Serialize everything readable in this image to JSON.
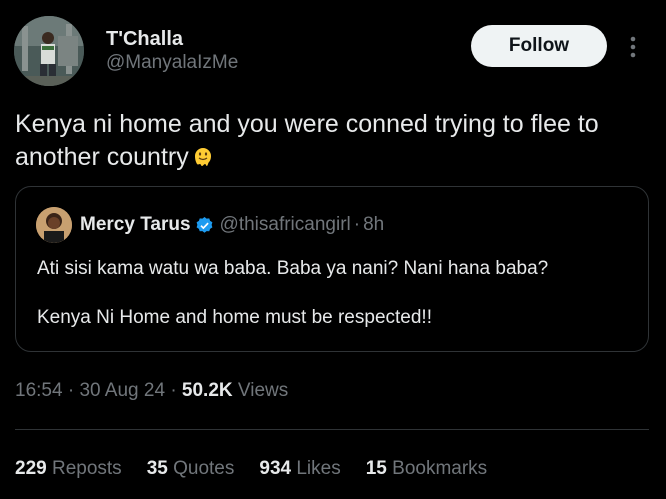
{
  "author": {
    "name": "T'Challa",
    "handle": "@ManyalaIzMe"
  },
  "follow_label": "Follow",
  "tweet": {
    "text": "Kenya ni home and you were conned trying to flee to another country",
    "emoji_icon": "melting-face-emoji-icon"
  },
  "quote": {
    "name": "Mercy Tarus",
    "handle": "@thisafricangirl",
    "separator": "·",
    "time": "8h",
    "paragraphs": [
      "Ati sisi kama watu wa baba. Baba ya nani? Nani hana baba?",
      "Kenya Ni Home and home must be respected!!"
    ]
  },
  "meta": {
    "time": "16:54",
    "sep1": "·",
    "date": "30 Aug 24",
    "sep2": "·",
    "views_count": "50.2K",
    "views_label": "Views"
  },
  "stats": {
    "reposts_count": "229",
    "reposts_label": "Reposts",
    "quotes_count": "35",
    "quotes_label": "Quotes",
    "likes_count": "934",
    "likes_label": "Likes",
    "bookmarks_count": "15",
    "bookmarks_label": "Bookmarks"
  },
  "colors": {
    "background": "#000000",
    "text_primary": "#e7e9ea",
    "text_secondary": "#71767b",
    "border": "#2f3336",
    "follow_bg": "#eff3f4",
    "verified_blue": "#1d9bf0"
  }
}
